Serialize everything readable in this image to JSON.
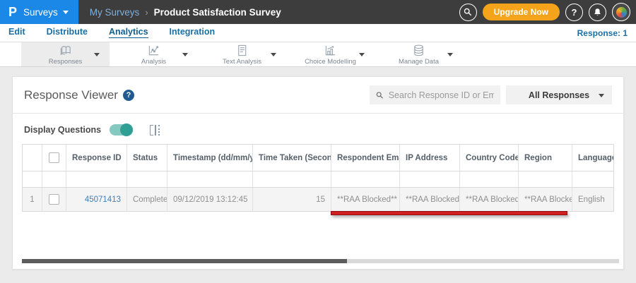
{
  "topbar": {
    "logo_letter": "P",
    "app_menu_label": "Surveys",
    "breadcrumb_parent": "My Surveys",
    "breadcrumb_separator": "›",
    "breadcrumb_current": "Product Satisfaction Survey",
    "upgrade_button_label": "Upgrade Now",
    "help_glyph": "?"
  },
  "nav": {
    "tabs": [
      {
        "label": "Edit"
      },
      {
        "label": "Distribute"
      },
      {
        "label": "Analytics",
        "active": true
      },
      {
        "label": "Integration"
      }
    ],
    "response_count": "Response: 1"
  },
  "toolbar": {
    "items": [
      {
        "label": "Responses",
        "selected": true
      },
      {
        "label": "Analysis"
      },
      {
        "label": "Text Analysis"
      },
      {
        "label": "Choice Modelling"
      },
      {
        "label": "Manage Data"
      }
    ]
  },
  "viewer": {
    "title": "Response Viewer",
    "help_glyph": "?",
    "search_placeholder": "Search Response ID or Email",
    "responses_filter": "All Responses",
    "display_questions_label": "Display Questions",
    "display_questions_on": true
  },
  "table": {
    "headers": {
      "response_id": "Response ID",
      "status": "Status",
      "timestamp": "Timestamp (dd/mm/yyyy)",
      "time_taken": "Time Taken (Seconds)",
      "respondent_email": "Respondent Email",
      "ip_address": "IP Address",
      "country_code": "Country Code",
      "region": "Region",
      "language": "Language"
    },
    "rows": [
      {
        "num": "1",
        "response_id": "45071413",
        "status": "Completed",
        "timestamp": "09/12/2019 13:12:45",
        "time_taken": "15",
        "respondent_email": "**RAA Blocked**",
        "ip_address": "**RAA Blocked**",
        "country_code": "**RAA Blocked**",
        "region": "**RAA Blocked**",
        "language": "English"
      }
    ]
  },
  "colors": {
    "brand_blue": "#1b87e6",
    "topbar_bg": "#3d3d3d",
    "upgrade_orange": "#f5a31b",
    "link_blue": "#1a6fa5",
    "toggle_teal": "#2f9e93",
    "annotation_red": "#d21f1f",
    "response_id_blue": "#3f7fba"
  }
}
